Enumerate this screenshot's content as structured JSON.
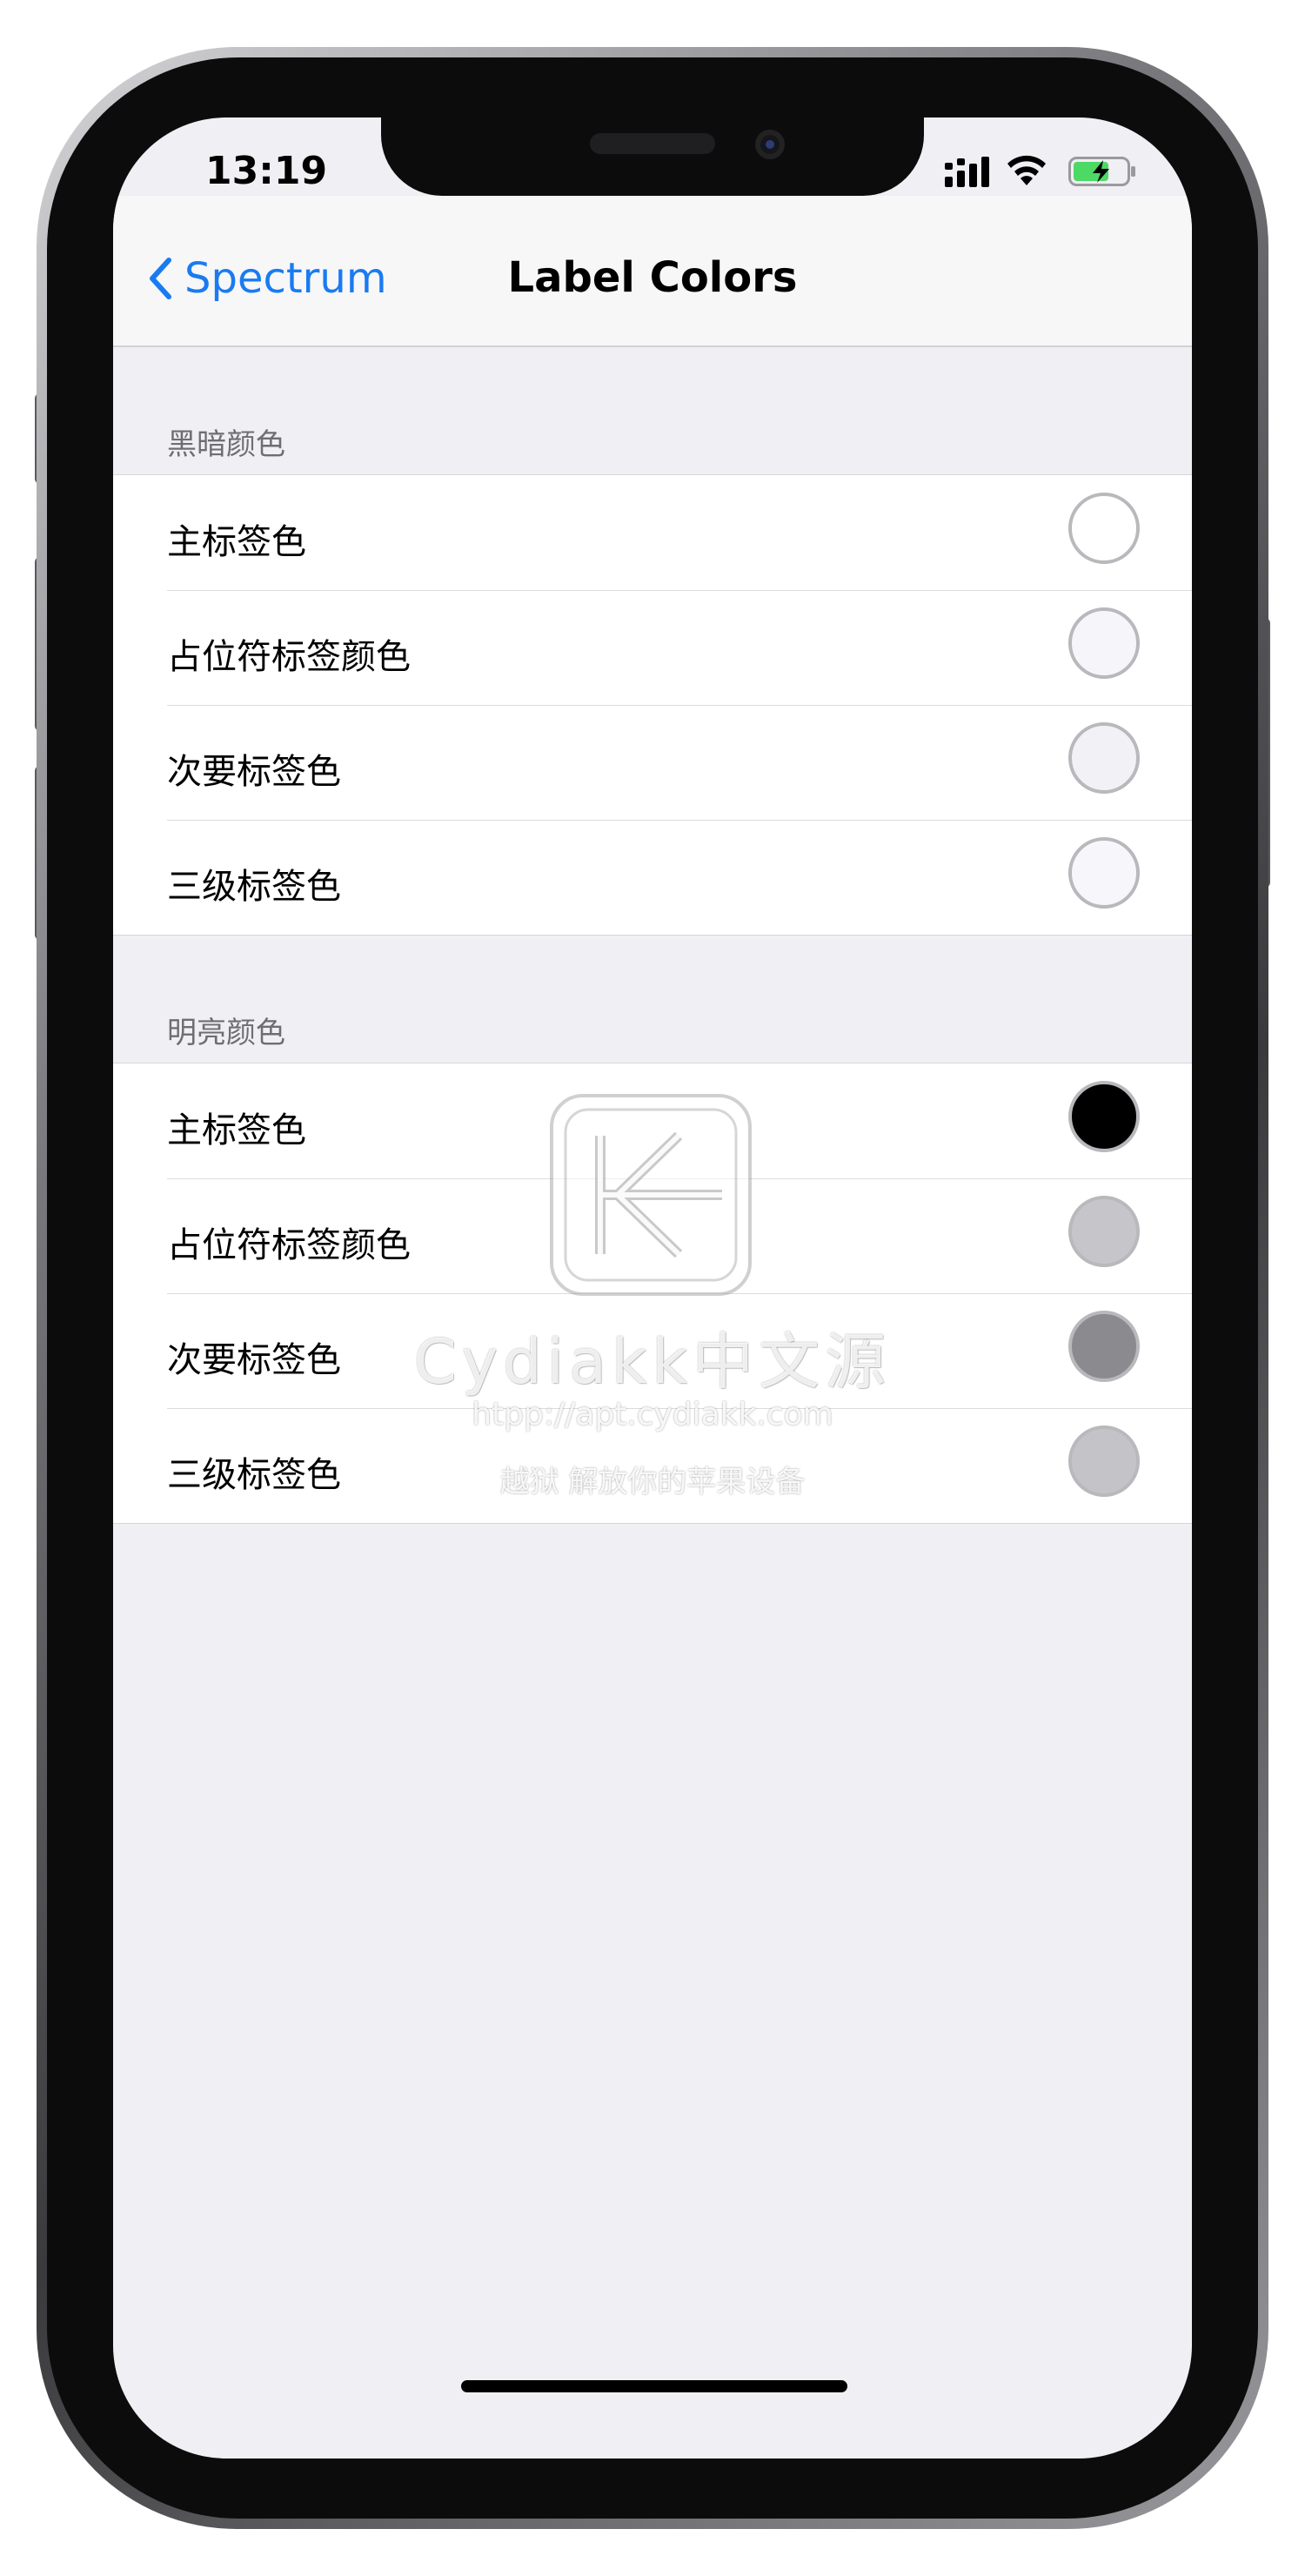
{
  "status_bar": {
    "time": "13:19"
  },
  "nav": {
    "back_label": "Spectrum",
    "title": "Label Colors"
  },
  "sections": [
    {
      "header": "黑暗颜色",
      "rows": [
        {
          "label": "主标签色",
          "swatch": "#ffffff"
        },
        {
          "label": "占位符标签颜色",
          "swatch": "#f6f6fa"
        },
        {
          "label": "次要标签色",
          "swatch": "#f1f1f6"
        },
        {
          "label": "三级标签色",
          "swatch": "#f7f7fb"
        }
      ]
    },
    {
      "header": "明亮颜色",
      "rows": [
        {
          "label": "主标签色",
          "swatch": "#000000"
        },
        {
          "label": "占位符标签颜色",
          "swatch": "#c6c6ca"
        },
        {
          "label": "次要标签色",
          "swatch": "#8a8a8f"
        },
        {
          "label": "三级标签色",
          "swatch": "#c4c4c8"
        }
      ]
    }
  ],
  "watermark": {
    "title": "Cydiakk中文源",
    "url": "htpp://apt.cydiakk.com",
    "tagline": "越狱 解放你的苹果设备"
  },
  "colors": {
    "accent": "#1a7bf0",
    "background": "#efeff4",
    "battery_green": "#4cd964"
  }
}
